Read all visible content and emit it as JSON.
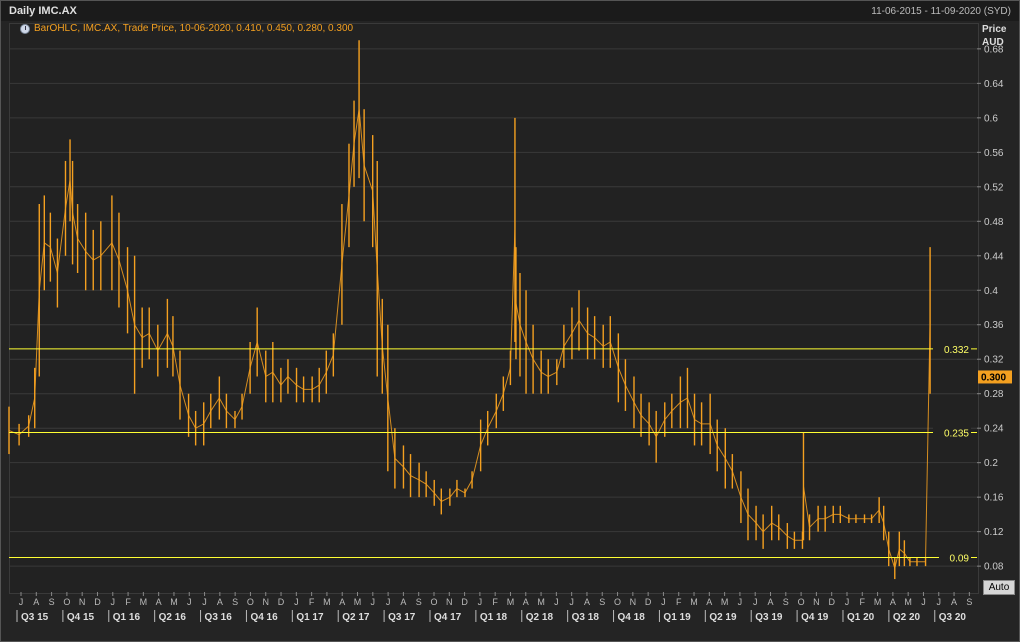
{
  "window": {
    "title": "Daily IMC.AX",
    "date_range": "11-06-2015 - 11-09-2020 (SYD)"
  },
  "legend": {
    "text": "BarOHLC, IMC.AX, Trade Price,  10-06-2020, 0.410, 0.450, 0.280, 0.300",
    "icon": "clock-icon"
  },
  "axis": {
    "price_label": "Price",
    "currency_label": "AUD",
    "auto_label": "Auto"
  },
  "colors": {
    "background": "#222222",
    "price_series": "#f4a020",
    "hline": "#ffff33",
    "grid": "#3a3a3a",
    "last_price_tag": "#f4a020"
  },
  "chart_data": {
    "type": "bar",
    "style": "OHLC",
    "instrument": "IMC.AX",
    "last_price": "0.300",
    "ylim": [
      0.05,
      0.71
    ],
    "yticks": [
      {
        "value": 0.08,
        "label": "0.08"
      },
      {
        "value": 0.12,
        "label": "0.12"
      },
      {
        "value": 0.16,
        "label": "0.16"
      },
      {
        "value": 0.2,
        "label": "0.2"
      },
      {
        "value": 0.24,
        "label": "0.24"
      },
      {
        "value": 0.28,
        "label": "0.28"
      },
      {
        "value": 0.32,
        "label": "0.32"
      },
      {
        "value": 0.36,
        "label": "0.36"
      },
      {
        "value": 0.4,
        "label": "0.4"
      },
      {
        "value": 0.44,
        "label": "0.44"
      },
      {
        "value": 0.48,
        "label": "0.48"
      },
      {
        "value": 0.52,
        "label": "0.52"
      },
      {
        "value": 0.56,
        "label": "0.56"
      },
      {
        "value": 0.6,
        "label": "0.6"
      },
      {
        "value": 0.64,
        "label": "0.64"
      },
      {
        "value": 0.68,
        "label": "0.68"
      }
    ],
    "horizontal_lines": [
      {
        "value": 0.332,
        "label": "0.332"
      },
      {
        "value": 0.235,
        "label": "0.235"
      },
      {
        "value": 0.09,
        "label": "0.09"
      }
    ],
    "months": [
      "J",
      "A",
      "S",
      "O",
      "N",
      "D",
      "J",
      "F",
      "M",
      "A",
      "M",
      "J",
      "J",
      "A",
      "S",
      "O",
      "N",
      "D",
      "J",
      "F",
      "M",
      "A",
      "M",
      "J",
      "J",
      "A",
      "S",
      "O",
      "N",
      "D",
      "J",
      "F",
      "M",
      "A",
      "M",
      "J",
      "J",
      "A",
      "S",
      "O",
      "N",
      "D",
      "J",
      "F",
      "M",
      "A",
      "M",
      "J",
      "J",
      "A",
      "S",
      "O",
      "N",
      "D",
      "J",
      "F",
      "M",
      "A",
      "M",
      "J",
      "J",
      "A",
      "S"
    ],
    "quarters": [
      {
        "label": "Q3 15",
        "month_index": 0
      },
      {
        "label": "Q4 15",
        "month_index": 3
      },
      {
        "label": "Q1 16",
        "month_index": 6
      },
      {
        "label": "Q2 16",
        "month_index": 9
      },
      {
        "label": "Q3 16",
        "month_index": 12
      },
      {
        "label": "Q4 16",
        "month_index": 15
      },
      {
        "label": "Q1 17",
        "month_index": 18
      },
      {
        "label": "Q2 17",
        "month_index": 21
      },
      {
        "label": "Q3 17",
        "month_index": 24
      },
      {
        "label": "Q4 17",
        "month_index": 27
      },
      {
        "label": "Q1 18",
        "month_index": 30
      },
      {
        "label": "Q2 18",
        "month_index": 33
      },
      {
        "label": "Q3 18",
        "month_index": 36
      },
      {
        "label": "Q4 18",
        "month_index": 39
      },
      {
        "label": "Q1 19",
        "month_index": 42
      },
      {
        "label": "Q2 19",
        "month_index": 45
      },
      {
        "label": "Q3 19",
        "month_index": 48
      },
      {
        "label": "Q4 19",
        "month_index": 51
      },
      {
        "label": "Q1 20",
        "month_index": 54
      },
      {
        "label": "Q2 20",
        "month_index": 57
      },
      {
        "label": "Q3 20",
        "month_index": 60
      }
    ],
    "series": [
      {
        "x": [
          "2015-06-11",
          "2015-07-01",
          "2015-07-20",
          "2015-08-01",
          "2015-08-10",
          "2015-08-20",
          "2015-09-01",
          "2015-09-15",
          "2015-10-01",
          "2015-10-10",
          "2015-10-15",
          "2015-10-25",
          "2015-11-10",
          "2015-11-25",
          "2015-12-10",
          "2016-01-01",
          "2016-01-15",
          "2016-02-01",
          "2016-02-15",
          "2016-03-01",
          "2016-03-15",
          "2016-04-01",
          "2016-04-20",
          "2016-05-01",
          "2016-05-15",
          "2016-06-01",
          "2016-06-15",
          "2016-07-01",
          "2016-07-15",
          "2016-08-01",
          "2016-08-15",
          "2016-09-01",
          "2016-09-15",
          "2016-10-01",
          "2016-10-15",
          "2016-11-01",
          "2016-11-15",
          "2016-12-01",
          "2016-12-15",
          "2017-01-01",
          "2017-01-15",
          "2017-02-01",
          "2017-02-15",
          "2017-03-01",
          "2017-03-15",
          "2017-04-01",
          "2017-04-15",
          "2017-04-25",
          "2017-05-05",
          "2017-05-15",
          "2017-06-01",
          "2017-06-10",
          "2017-06-20",
          "2017-07-01",
          "2017-07-15",
          "2017-08-01",
          "2017-08-15",
          "2017-09-01",
          "2017-09-15",
          "2017-10-01",
          "2017-10-15",
          "2017-11-01",
          "2017-11-15",
          "2017-12-01",
          "2017-12-15",
          "2018-01-01",
          "2018-01-15",
          "2018-02-01",
          "2018-02-15",
          "2018-03-01",
          "2018-03-10",
          "2018-03-12",
          "2018-03-20",
          "2018-04-01",
          "2018-04-15",
          "2018-05-01",
          "2018-05-15",
          "2018-06-01",
          "2018-06-15",
          "2018-07-01",
          "2018-07-15",
          "2018-08-01",
          "2018-08-15",
          "2018-09-01",
          "2018-09-15",
          "2018-10-01",
          "2018-10-15",
          "2018-11-01",
          "2018-11-15",
          "2018-12-01",
          "2018-12-15",
          "2019-01-01",
          "2019-01-15",
          "2019-02-01",
          "2019-02-15",
          "2019-03-01",
          "2019-03-15",
          "2019-04-01",
          "2019-04-15",
          "2019-05-01",
          "2019-05-15",
          "2019-06-01",
          "2019-06-15",
          "2019-07-01",
          "2019-07-15",
          "2019-08-01",
          "2019-08-15",
          "2019-09-01",
          "2019-09-15",
          "2019-10-01",
          "2019-10-03",
          "2019-10-15",
          "2019-11-01",
          "2019-11-15",
          "2019-12-01",
          "2019-12-15",
          "2020-01-01",
          "2020-01-15",
          "2020-02-01",
          "2020-02-15",
          "2020-03-01",
          "2020-03-10",
          "2020-03-20",
          "2020-04-01",
          "2020-04-10",
          "2020-04-20",
          "2020-05-01",
          "2020-05-15",
          "2020-06-01",
          "2020-06-10"
        ],
        "high": [
          0.265,
          0.245,
          0.255,
          0.31,
          0.5,
          0.51,
          0.49,
          0.46,
          0.55,
          0.575,
          0.55,
          0.5,
          0.49,
          0.47,
          0.48,
          0.51,
          0.49,
          0.45,
          0.44,
          0.38,
          0.38,
          0.36,
          0.39,
          0.37,
          0.33,
          0.28,
          0.26,
          0.27,
          0.28,
          0.3,
          0.28,
          0.26,
          0.28,
          0.34,
          0.38,
          0.33,
          0.34,
          0.31,
          0.32,
          0.31,
          0.3,
          0.3,
          0.31,
          0.33,
          0.35,
          0.5,
          0.57,
          0.62,
          0.69,
          0.61,
          0.58,
          0.55,
          0.39,
          0.36,
          0.24,
          0.22,
          0.21,
          0.2,
          0.19,
          0.18,
          0.17,
          0.17,
          0.18,
          0.17,
          0.19,
          0.25,
          0.26,
          0.28,
          0.3,
          0.33,
          0.6,
          0.45,
          0.42,
          0.4,
          0.36,
          0.33,
          0.32,
          0.32,
          0.36,
          0.38,
          0.4,
          0.38,
          0.37,
          0.36,
          0.37,
          0.35,
          0.32,
          0.3,
          0.28,
          0.27,
          0.26,
          0.27,
          0.28,
          0.3,
          0.31,
          0.28,
          0.27,
          0.28,
          0.25,
          0.24,
          0.21,
          0.19,
          0.17,
          0.15,
          0.14,
          0.15,
          0.14,
          0.13,
          0.12,
          0.12,
          0.235,
          0.14,
          0.15,
          0.15,
          0.15,
          0.15,
          0.14,
          0.14,
          0.14,
          0.14,
          0.16,
          0.15,
          0.12,
          0.09,
          0.12,
          0.11,
          0.09,
          0.09,
          0.09,
          0.45
        ],
        "low": [
          0.21,
          0.22,
          0.23,
          0.24,
          0.3,
          0.4,
          0.41,
          0.38,
          0.44,
          0.48,
          0.43,
          0.42,
          0.4,
          0.4,
          0.4,
          0.4,
          0.38,
          0.35,
          0.28,
          0.31,
          0.32,
          0.3,
          0.31,
          0.3,
          0.25,
          0.23,
          0.22,
          0.22,
          0.24,
          0.25,
          0.24,
          0.24,
          0.25,
          0.28,
          0.3,
          0.27,
          0.27,
          0.27,
          0.28,
          0.27,
          0.27,
          0.27,
          0.27,
          0.28,
          0.3,
          0.36,
          0.45,
          0.52,
          0.53,
          0.48,
          0.45,
          0.3,
          0.28,
          0.19,
          0.17,
          0.17,
          0.16,
          0.16,
          0.16,
          0.15,
          0.14,
          0.15,
          0.16,
          0.16,
          0.17,
          0.19,
          0.22,
          0.24,
          0.26,
          0.29,
          0.34,
          0.32,
          0.3,
          0.28,
          0.28,
          0.28,
          0.28,
          0.29,
          0.31,
          0.32,
          0.33,
          0.32,
          0.32,
          0.31,
          0.31,
          0.27,
          0.26,
          0.24,
          0.23,
          0.22,
          0.2,
          0.23,
          0.24,
          0.24,
          0.24,
          0.22,
          0.22,
          0.21,
          0.19,
          0.17,
          0.17,
          0.13,
          0.11,
          0.11,
          0.1,
          0.11,
          0.11,
          0.1,
          0.1,
          0.1,
          0.11,
          0.11,
          0.12,
          0.12,
          0.13,
          0.13,
          0.13,
          0.13,
          0.13,
          0.13,
          0.13,
          0.11,
          0.08,
          0.065,
          0.08,
          0.08,
          0.08,
          0.08,
          0.08,
          0.28
        ]
      }
    ]
  }
}
